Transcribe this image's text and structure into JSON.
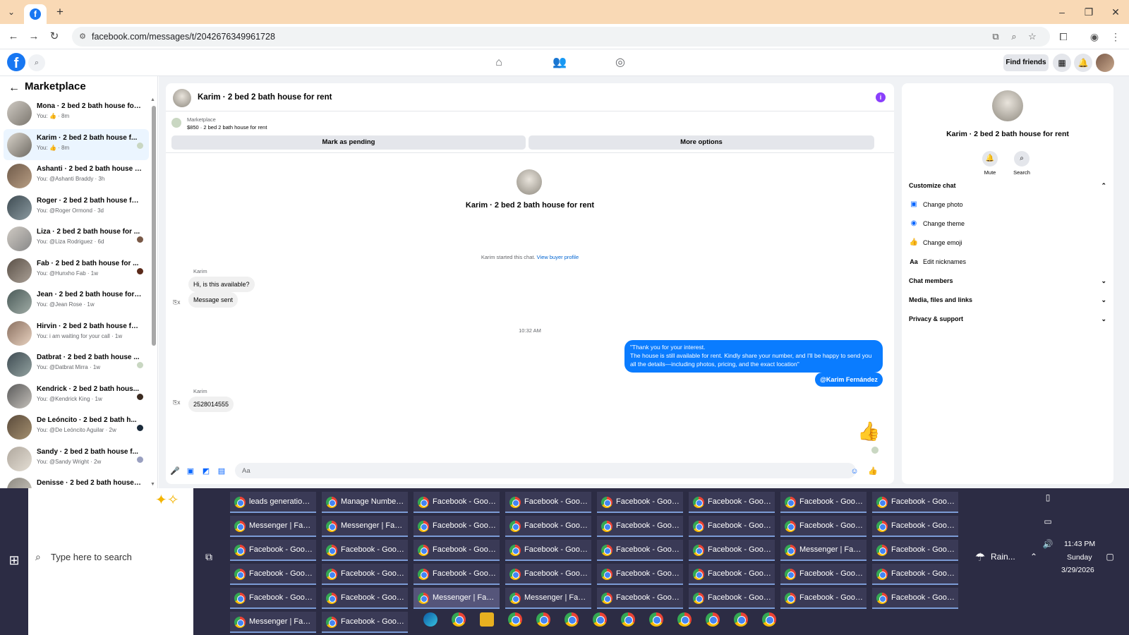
{
  "browser": {
    "url": "facebook.com/messages/t/2042676349961728"
  },
  "fb_header": {
    "find_friends": "Find friends"
  },
  "left": {
    "title": "Marketplace",
    "conversations": [
      {
        "title": "Mona · 2 bed 2 bath house for r...",
        "sub": "You: 👍 · 8m",
        "active": false
      },
      {
        "title": "Karim · 2 bed 2 bath house f...",
        "sub": "You: 👍 · 8m",
        "active": true
      },
      {
        "title": "Ashanti · 2 bed 2 bath house fo...",
        "sub": "You: @Ashanti Braddy · 3h",
        "active": false
      },
      {
        "title": "Roger · 2 bed 2 bath house for ...",
        "sub": "You: @Roger Ormond · 3d",
        "active": false
      },
      {
        "title": "Liza · 2 bed 2 bath house for ...",
        "sub": "You: @Liza Rodriguez · 6d",
        "active": false
      },
      {
        "title": "Fab · 2 bed 2 bath house for ...",
        "sub": "You: @Hunxho Fab · 1w",
        "active": false
      },
      {
        "title": "Jean · 2 bed 2 bath house for re...",
        "sub": "You: @Jean Rose · 1w",
        "active": false
      },
      {
        "title": "Hirvin · 2 bed 2 bath house for ...",
        "sub": "You: i am waiting for your call · 1w",
        "active": false
      },
      {
        "title": "Datbrat · 2 bed 2 bath house ...",
        "sub": "You: @Datbrat Mirra · 1w",
        "active": false
      },
      {
        "title": "Kendrick · 2 bed 2 bath hous...",
        "sub": "You: @Kendrick King · 1w",
        "active": false
      },
      {
        "title": "De Leóncito · 2 bed 2 bath h...",
        "sub": "You: @De Leóncito Aguilar · 2w",
        "active": false
      },
      {
        "title": "Sandy · 2 bed 2 bath house f...",
        "sub": "You: @Sandy Wright · 2w",
        "active": false
      },
      {
        "title": "Denisse · 2 bed 2 bath house fo...",
        "sub": "",
        "active": false
      }
    ]
  },
  "chat": {
    "header_title": "Karim · 2 bed 2 bath house for rent",
    "marketplace_label": "Marketplace",
    "listing": "$850 · 2 bed 2 bath house for rent",
    "mark_pending": "Mark as pending",
    "more_options": "More options",
    "center_name": "Karim · 2 bed 2 bath house for rent",
    "started_text": "Karim started this chat.",
    "view_buyer_profile": "View buyer profile",
    "sender1": "Karim",
    "msg1": "Hi, is this available?",
    "msg2": "Message sent",
    "timestamp": "10:32 AM",
    "outgoing": "\"Thank you for your interest.\nThe house is still available for rent. Kindly share your number, and I'll be happy to send you all the details—including photos, pricing, and the exact location\"",
    "mention": "@Karim Fernández",
    "sender2": "Karim",
    "msg3": "2528014555",
    "composer_placeholder": "Aa"
  },
  "right": {
    "name": "Karim · 2 bed 2 bath house for rent",
    "mute": "Mute",
    "search": "Search",
    "customize_chat": "Customize chat",
    "change_photo": "Change photo",
    "change_theme": "Change theme",
    "change_emoji": "Change emoji",
    "edit_nicknames": "Edit nicknames",
    "chat_members": "Chat members",
    "media_files_links": "Media, files and links",
    "privacy_support": "Privacy & support"
  },
  "taskbar": {
    "search_placeholder": "Type here to search",
    "weather": "Rain...",
    "time": "11:43 PM",
    "day": "Sunday",
    "date": "3/29/2026",
    "rows": [
      [
        "leads generation - ...",
        "Manage Numbers ...",
        "Facebook - Googl...",
        "Facebook - Googl...",
        "Facebook - Googl...",
        "Facebook - Googl...",
        "Facebook - Googl...",
        "Facebook - Googl..."
      ],
      [
        "Messenger | Faceb...",
        "Messenger | Faceb...",
        "Facebook - Googl...",
        "Facebook - Googl...",
        "Facebook - Googl...",
        "Facebook - Googl...",
        "Facebook - Googl...",
        "Facebook - Googl..."
      ],
      [
        "Facebook - Googl...",
        "Facebook - Googl...",
        "Facebook - Googl...",
        "Facebook - Googl...",
        "Facebook - Googl...",
        "Facebook - Googl...",
        "Messenger | Faceb...",
        "Facebook - Googl..."
      ],
      [
        "Facebook - Googl...",
        "Facebook - Googl...",
        "Facebook - Googl...",
        "Facebook - Googl...",
        "Facebook - Googl...",
        "Facebook - Googl...",
        "Facebook - Googl...",
        "Facebook - Googl..."
      ],
      [
        "Facebook - Googl...",
        "Facebook - Googl...",
        "Messenger | Faceb...",
        "Messenger | Faceb...",
        "Facebook - Googl...",
        "Facebook - Googl...",
        "Facebook - Googl...",
        "Facebook - Googl..."
      ],
      [
        "Messenger | Faceb...",
        "Facebook - Google ..."
      ]
    ],
    "selected": [
      4,
      2
    ]
  }
}
